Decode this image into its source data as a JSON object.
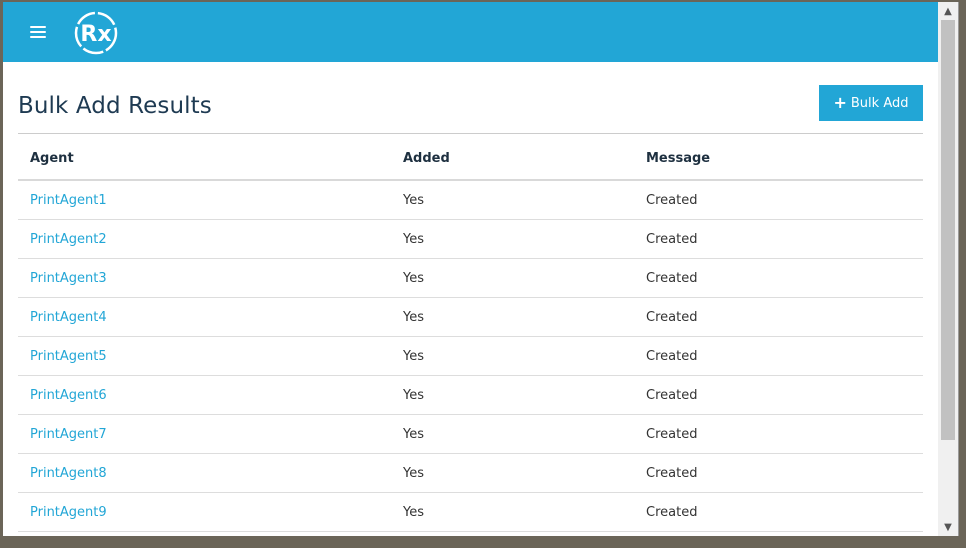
{
  "header": {
    "menu_icon": "hamburger-menu-icon",
    "logo_text": "Rx",
    "accent_color": "#22a6d6"
  },
  "page": {
    "title": "Bulk Add Results",
    "bulk_add_button": {
      "icon": "plus-icon",
      "icon_glyph": "+",
      "label": "Bulk Add"
    }
  },
  "table": {
    "columns": [
      "Agent",
      "Added",
      "Message"
    ],
    "rows": [
      {
        "agent": "PrintAgent1",
        "added": "Yes",
        "message": "Created"
      },
      {
        "agent": "PrintAgent2",
        "added": "Yes",
        "message": "Created"
      },
      {
        "agent": "PrintAgent3",
        "added": "Yes",
        "message": "Created"
      },
      {
        "agent": "PrintAgent4",
        "added": "Yes",
        "message": "Created"
      },
      {
        "agent": "PrintAgent5",
        "added": "Yes",
        "message": "Created"
      },
      {
        "agent": "PrintAgent6",
        "added": "Yes",
        "message": "Created"
      },
      {
        "agent": "PrintAgent7",
        "added": "Yes",
        "message": "Created"
      },
      {
        "agent": "PrintAgent8",
        "added": "Yes",
        "message": "Created"
      },
      {
        "agent": "PrintAgent9",
        "added": "Yes",
        "message": "Created"
      }
    ]
  }
}
